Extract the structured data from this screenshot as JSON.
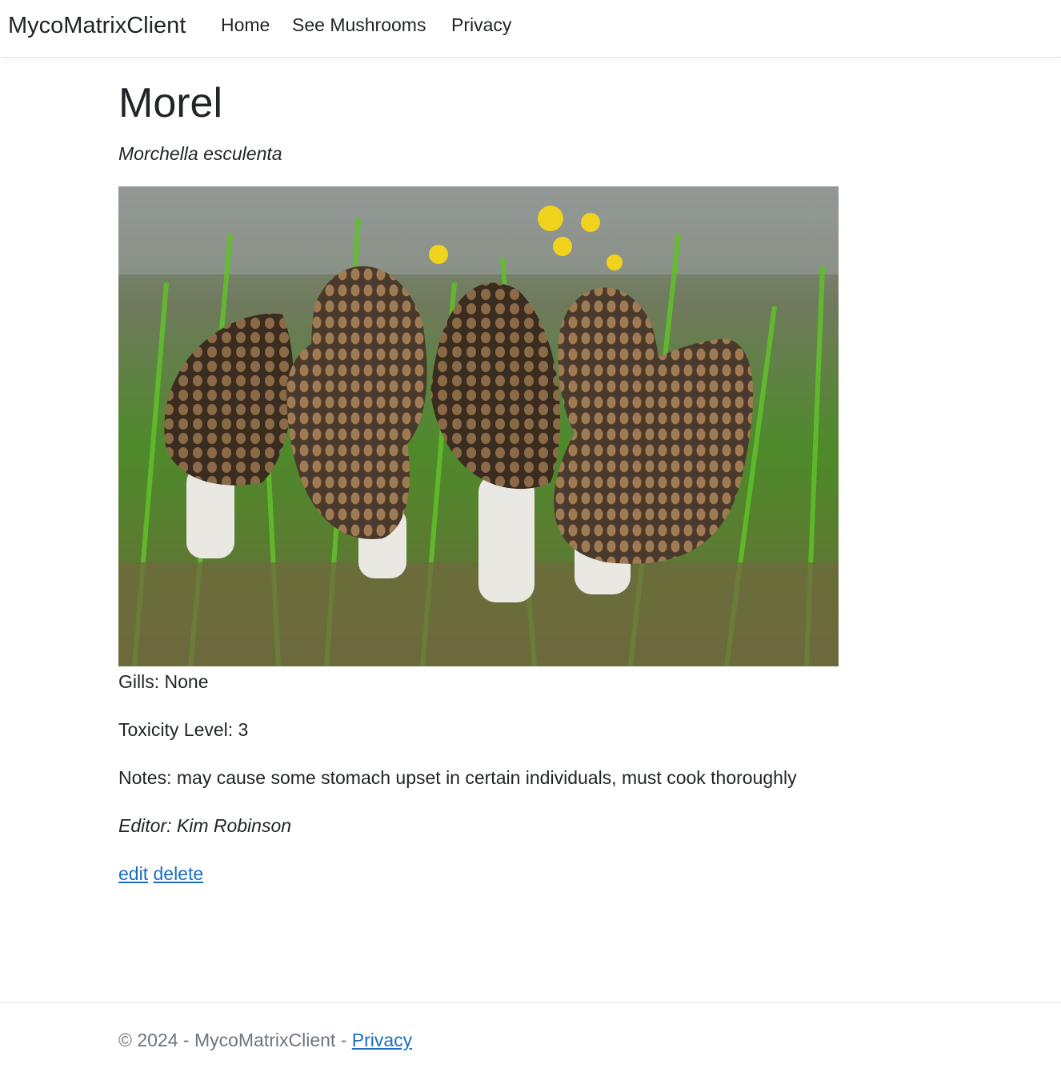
{
  "navbar": {
    "brand": "MycoMatrixClient",
    "links": [
      "Home",
      "See Mushrooms",
      "Privacy"
    ]
  },
  "mushroom": {
    "name": "Morel",
    "scientific_name": "Morchella esculenta",
    "image_alt": "Morel mushrooms in grass",
    "gills": "Gills: None",
    "toxicity": "Toxicity Level: 3",
    "notes": "Notes: may cause some stomach upset in certain individuals, must cook thoroughly",
    "editor": "Editor: Kim Robinson"
  },
  "actions": {
    "edit_label": "edit",
    "delete_label": "delete"
  },
  "footer": {
    "prefix": "© 2024 - MycoMatrixClient - ",
    "privacy_label": "Privacy"
  },
  "colors": {
    "link": "#1b6ec2",
    "text": "#212529",
    "muted": "#6c757d"
  }
}
